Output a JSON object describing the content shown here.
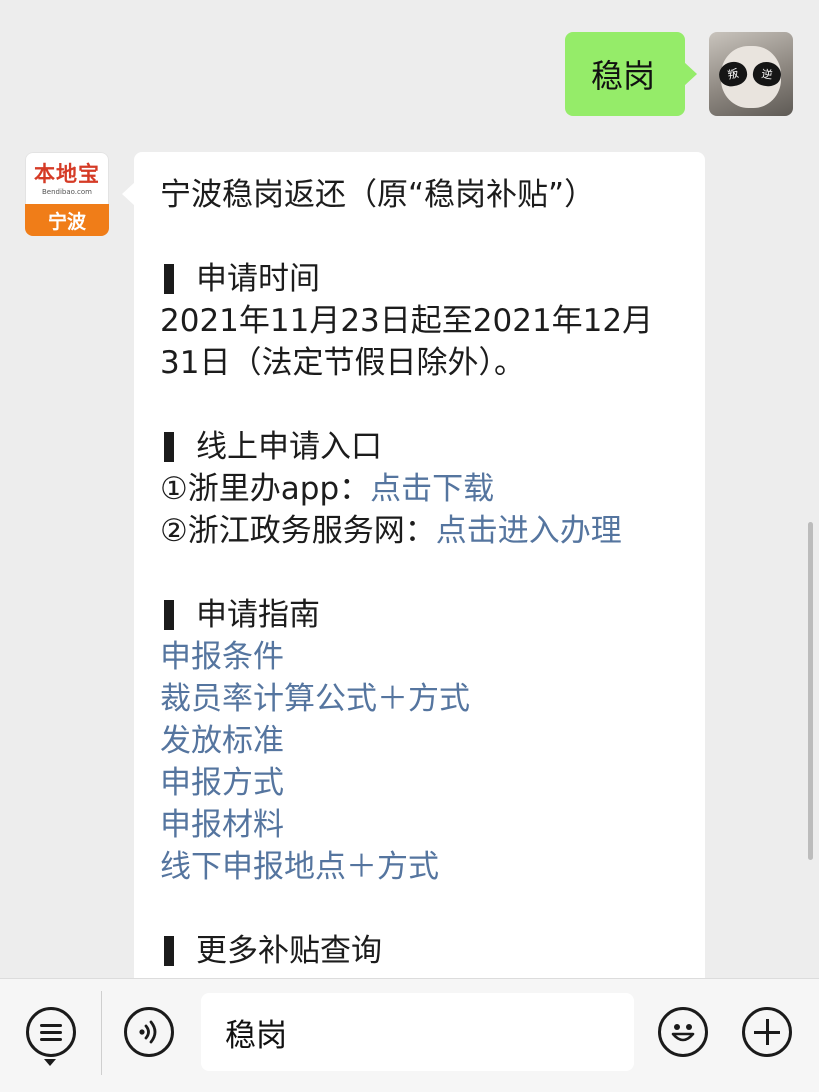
{
  "outgoing": {
    "text": "稳岗",
    "avatar_shade_left": "叛",
    "avatar_shade_right": "逆"
  },
  "sender": {
    "logo_text": "本地宝",
    "logo_sub": "Bendibao.com",
    "city": "宁波"
  },
  "message": {
    "title": "宁波稳岗返还（原“稳岗补贴”）",
    "sections": [
      {
        "heading": "申请时间",
        "lines": [
          "2021年11月23日起至2021年12月",
          "31日（法定节假日除外）。"
        ]
      },
      {
        "heading": "线上申请入口",
        "entries": [
          {
            "prefix": "①浙里办app：",
            "link": "点击下载"
          },
          {
            "prefix": "②浙江政务服务网：",
            "link": "点击进入办理"
          }
        ]
      },
      {
        "heading": "申请指南",
        "links": [
          "申报条件",
          "裁员率计算公式＋方式",
          "发放标准",
          "申报方式",
          "申报材料",
          "线下申报地点＋方式"
        ]
      },
      {
        "heading": "更多补贴查询"
      }
    ]
  },
  "input_bar": {
    "text_value": "稳岗"
  },
  "icons": {
    "menu": "list-menu-icon",
    "voice": "voice-icon",
    "emoji": "emoji-icon",
    "plus": "plus-icon"
  },
  "colors": {
    "outgoing_bubble": "#95ec69",
    "link": "#55759f",
    "background": "#ededed"
  }
}
